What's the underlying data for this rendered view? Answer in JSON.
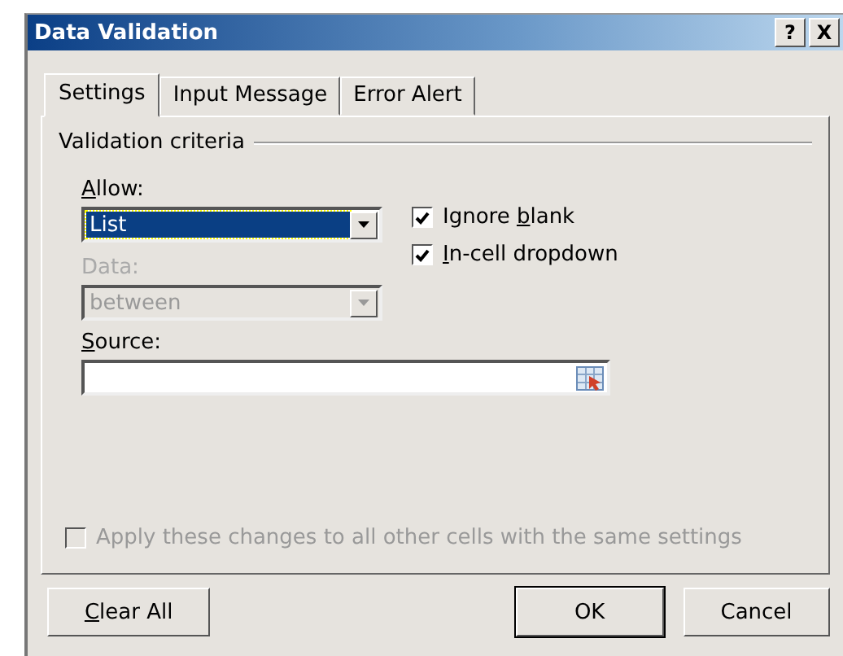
{
  "window": {
    "title": "Data Validation",
    "title_buttons": [
      "?",
      "X"
    ]
  },
  "tabs": [
    {
      "label": "Settings",
      "selected": true
    },
    {
      "label": "Input Message",
      "selected": false
    },
    {
      "label": "Error Alert",
      "selected": false
    }
  ],
  "group": {
    "title": "Validation criteria"
  },
  "allow": {
    "label": [
      {
        "text": "A",
        "underlined": true
      },
      {
        "text": "llow:",
        "underlined": false
      }
    ],
    "value": "List",
    "focused": true,
    "disabled": false
  },
  "data": {
    "label": "Data:",
    "value": "between",
    "disabled": true
  },
  "checkboxes": [
    {
      "label": [
        {
          "text": "Ignore ",
          "underlined": false
        },
        {
          "text": "b",
          "underlined": true
        },
        {
          "text": "lank",
          "underlined": false
        }
      ],
      "checked": true,
      "disabled": false
    },
    {
      "label": [
        {
          "text": "I",
          "underlined": true
        },
        {
          "text": "n-cell dropdown",
          "underlined": false
        }
      ],
      "checked": true,
      "disabled": false
    }
  ],
  "source": {
    "label": [
      {
        "text": "S",
        "underlined": true
      },
      {
        "text": "ource:",
        "underlined": false
      }
    ]
  },
  "apply_all": {
    "label": "Apply these changes to all other cells with the same settings",
    "checked": false,
    "disabled": true
  },
  "buttons": [
    {
      "label": [
        {
          "text": "C",
          "underlined": true
        },
        {
          "text": "lear All",
          "underlined": false
        }
      ],
      "default": false
    },
    {
      "label": [
        {
          "text": "OK",
          "underlined": false
        }
      ],
      "default": true
    },
    {
      "label": [
        {
          "text": "Cancel",
          "underlined": false
        }
      ],
      "default": false
    }
  ]
}
